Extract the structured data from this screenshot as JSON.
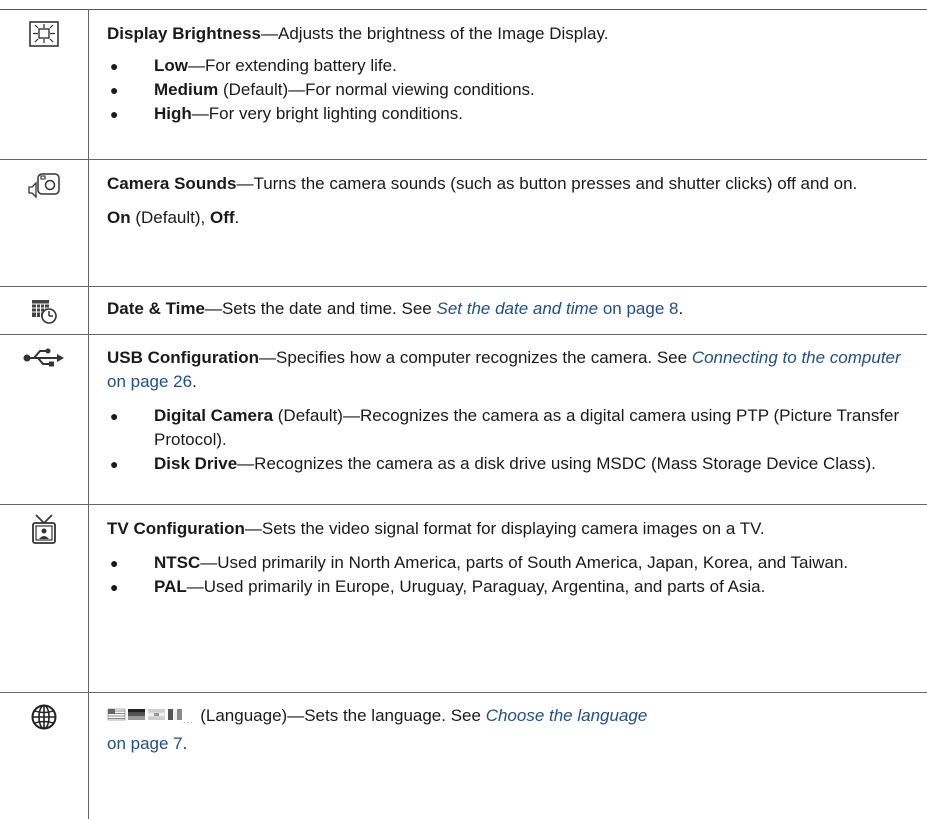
{
  "rows": {
    "brightness": {
      "icon": "display-brightness-icon",
      "title": "Display Brightness",
      "desc": "—Adjusts the brightness of the Image Display.",
      "bullets": [
        {
          "label": "Low",
          "text": "—For extending battery life."
        },
        {
          "label": "Medium",
          "text": " (Default)—For normal viewing conditions."
        },
        {
          "label": "High",
          "text": "—For very bright lighting conditions."
        }
      ]
    },
    "sounds": {
      "icon": "camera-sounds-icon",
      "title": "Camera Sounds",
      "desc": "—Turns the camera sounds (such as button presses and shutter clicks) off and on.",
      "opt_on": "On",
      "opt_default": " (Default), ",
      "opt_off": "Off",
      "opt_end": "."
    },
    "datetime": {
      "icon": "date-time-icon",
      "title": "Date & Time",
      "desc": "—Sets the date and time. See ",
      "link_text": "Set the date and time",
      "link_page": " on page 8",
      "end": "."
    },
    "usb": {
      "icon": "usb-icon",
      "title": "USB Configuration",
      "desc": "—Specifies how a computer recognizes the camera. See ",
      "link_text": "Connecting to the computer",
      "link_page": " on page 26",
      "end": ".",
      "bullets": [
        {
          "label": "Digital Camera",
          "text": "  (Default)—Recognizes the camera as a digital camera using PTP (Picture Transfer Protocol)."
        },
        {
          "label": "Disk Drive",
          "text": "—Recognizes the camera as a disk drive using MSDC (Mass Storage Device Class)."
        }
      ]
    },
    "tv": {
      "icon": "tv-icon",
      "title": "TV Configuration",
      "desc": "—Sets the video signal format for displaying camera images on a TV.",
      "bullets": [
        {
          "label": "NTSC",
          "text": "—Used primarily in North America, parts of South America, Japan, Korea, and Taiwan."
        },
        {
          "label": "PAL",
          "text": "—Used primarily in Europe, Uruguay, Paraguay, Argentina, and parts of Asia."
        }
      ]
    },
    "language": {
      "icon": "globe-icon",
      "flags_icon": "language-flags-icon",
      "title": " (Language)",
      "desc": "—Sets the language. See ",
      "link_text": "Choose the language",
      "link_page": "on page 7",
      "end": "."
    }
  },
  "bullet_glyph": "●"
}
